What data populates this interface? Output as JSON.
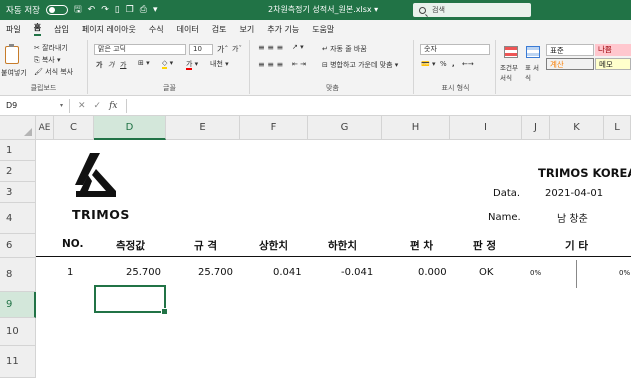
{
  "titlebar": {
    "autosave_label": "자동 저장",
    "autosave_state": "끔",
    "filename": "2차원측정기 성적서_원본.xlsx",
    "search_placeholder": "검색"
  },
  "menu": {
    "tabs": [
      "파일",
      "홈",
      "삽입",
      "페이지 레이아웃",
      "수식",
      "데이터",
      "검토",
      "보기",
      "추가 기능",
      "도움말"
    ],
    "active": "홈"
  },
  "ribbon": {
    "clipboard": {
      "paste": "붙여넣기",
      "cut": "잘라내기",
      "copy": "복사",
      "format_painter": "서식 복사",
      "label": "클립보드"
    },
    "font": {
      "name": "맑은 고딕",
      "size": "10",
      "grow": "가",
      "shrink": "가",
      "bold": "가",
      "italic": "가",
      "underline": "가",
      "label": "글꼴",
      "font_color_mark": "가",
      "phonetic": "내천"
    },
    "alignment": {
      "wrap": "자동 줄 바꿈",
      "merge": "병합하고 가운데 맞춤",
      "label": "맞춤"
    },
    "number": {
      "format": "숫자",
      "percent": "%",
      "comma": ",",
      "label": "표시 형식"
    },
    "styles": {
      "conditional": "조건부 서식",
      "table": "표 서식",
      "normal": "표준",
      "bad": "나쁨",
      "calc": "계산",
      "memo": "메모"
    }
  },
  "formula_bar": {
    "name_box": "D9",
    "fx": "fx",
    "value": ""
  },
  "grid": {
    "columns": [
      "AE",
      "C",
      "D",
      "E",
      "F",
      "G",
      "H",
      "I",
      "J",
      "K",
      "L"
    ],
    "selected_column": "D",
    "rows": [
      "1",
      "2",
      "3",
      "4",
      "6",
      "8",
      "9",
      "10",
      "11"
    ],
    "selected_row": "9",
    "logo_text": "TRIMOS",
    "company": "TRIMOS KOREA",
    "date_label": "Data.",
    "date_value": "2021-04-01",
    "name_label": "Name.",
    "name_value": "남 창춘",
    "headers": [
      "NO.",
      "측정값",
      "규 격",
      "상한치",
      "하한치",
      "편 차",
      "판 정",
      "기 타"
    ],
    "row8": {
      "no": "1",
      "measured": "25.700",
      "spec": "25.700",
      "upper": "0.041",
      "lower": "-0.041",
      "deviation": "0.000",
      "result": "OK",
      "pct1": "0%",
      "pct2": "0%"
    }
  }
}
